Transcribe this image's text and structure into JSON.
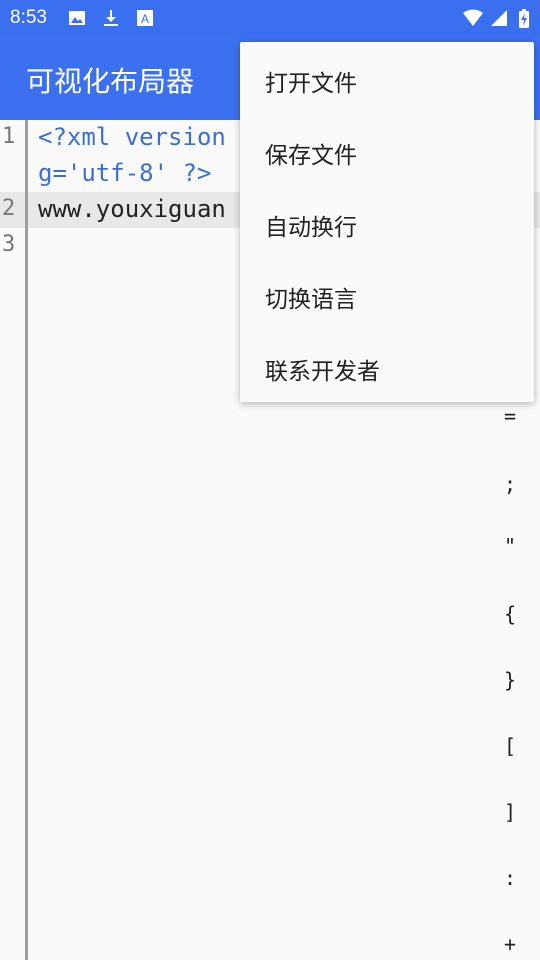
{
  "status": {
    "time": "8:53",
    "icons": [
      "image-icon",
      "download-icon",
      "font-icon",
      "wifi-icon",
      "cell-signal-icon",
      "battery-charging-icon"
    ]
  },
  "appbar": {
    "title": "可视化布局器"
  },
  "editor": {
    "lines": [
      {
        "num": "1",
        "text": "<?xml version"
      },
      {
        "num": "",
        "text": "g='utf-8' ?>"
      },
      {
        "num": "2",
        "text": "www.youxiguan"
      },
      {
        "num": "3",
        "text": ""
      }
    ],
    "symbols": [
      "=",
      ";",
      "\"",
      "{",
      "}",
      "[",
      "]",
      ":",
      "+"
    ]
  },
  "menu": {
    "items": [
      "打开文件",
      "保存文件",
      "自动换行",
      "切换语言",
      "联系开发者"
    ]
  },
  "colors": {
    "primary": "#3b70f0",
    "code_blue": "#3a6fd8"
  }
}
